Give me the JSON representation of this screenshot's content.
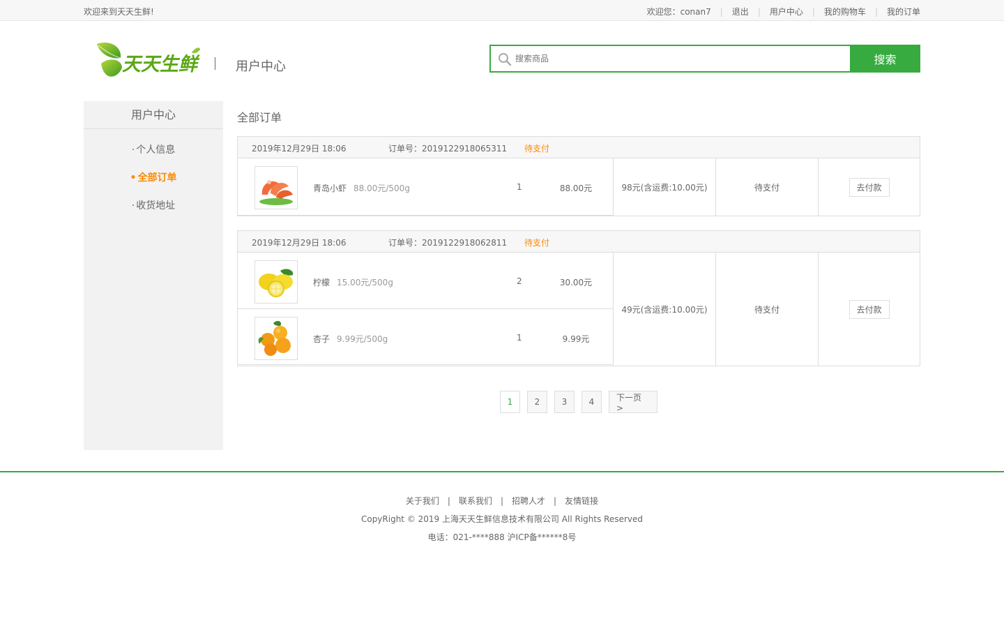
{
  "topbar": {
    "welcome": "欢迎来到天天生鲜!",
    "greeting": "欢迎您：conan7",
    "logout": "退出",
    "user_center": "用户中心",
    "cart": "我的购物车",
    "orders": "我的订单"
  },
  "header": {
    "logo_text": "天天生鲜",
    "subtitle": "用户中心",
    "search_placeholder": "搜索商品",
    "search_button": "搜索"
  },
  "sidebar": {
    "title": "用户中心",
    "items": [
      {
        "dot": "·",
        "label": "个人信息",
        "active": false
      },
      {
        "dot": "•",
        "label": "全部订单",
        "active": true
      },
      {
        "dot": "·",
        "label": "收货地址",
        "active": false
      }
    ]
  },
  "main": {
    "title": "全部订单"
  },
  "orders": [
    {
      "date": "2019年12月29日 18:06",
      "order_no": "订单号：2019122918065311",
      "status": "待支付",
      "goods": [
        {
          "name": "青岛小虾",
          "price": "88.00元/500g",
          "count": "1",
          "total": "88.00元",
          "image": "shrimp-image"
        }
      ],
      "amount": "98元(含运费:10.00元)",
      "pay_status": "待支付",
      "action": "去付款"
    },
    {
      "date": "2019年12月29日 18:06",
      "order_no": "订单号：2019122918062811",
      "status": "待支付",
      "goods": [
        {
          "name": "柠檬",
          "price": "15.00元/500g",
          "count": "2",
          "total": "30.00元",
          "image": "lemon-image"
        },
        {
          "name": "杏子",
          "price": "9.99元/500g",
          "count": "1",
          "total": "9.99元",
          "image": "apricot-image"
        }
      ],
      "amount": "49元(含运费:10.00元)",
      "pay_status": "待支付",
      "action": "去付款"
    }
  ],
  "pagination": {
    "pages": [
      "1",
      "2",
      "3",
      "4"
    ],
    "current": "1",
    "next": "下一页 >"
  },
  "footer": {
    "links": [
      "关于我们",
      "联系我们",
      "招聘人才",
      "友情链接"
    ],
    "separator": "|",
    "copyright": "CopyRight © 2019 上海天天生鲜信息技术有限公司 All Rights Reserved",
    "tel": "电话：021-****888 沪ICP备******8号"
  },
  "colors": {
    "brand_green": "#37ab40",
    "accent_orange": "#ff8800"
  }
}
